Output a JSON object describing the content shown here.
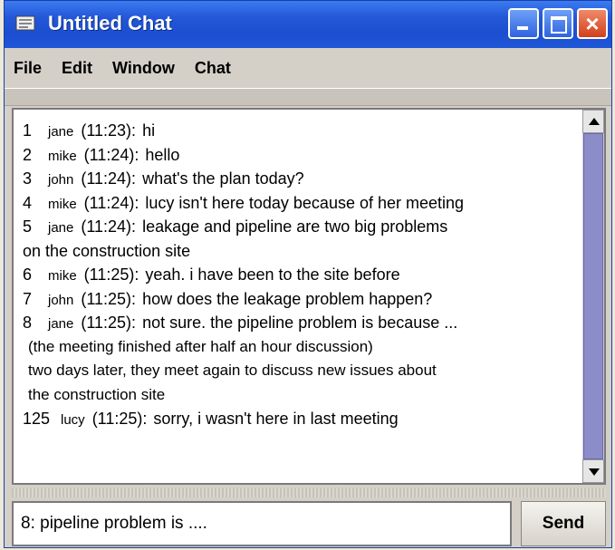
{
  "window": {
    "title": "Untitled Chat"
  },
  "menu": {
    "file": "File",
    "edit": "Edit",
    "window": "Window",
    "chat": "Chat"
  },
  "messages": [
    {
      "num": "1",
      "nick": "jane",
      "time": "(11:23):",
      "text": "hi"
    },
    {
      "num": "2",
      "nick": "mike",
      "time": "(11:24):",
      "text": "hello"
    },
    {
      "num": "3",
      "nick": "john",
      "time": "(11:24):",
      "text": "what's the plan today?"
    },
    {
      "num": "4",
      "nick": "mike",
      "time": "(11:24):",
      "text": "lucy isn't here today because of her meeting"
    },
    {
      "num": "5",
      "nick": "jane",
      "time": "(11:24):",
      "text": "leakage and pipeline are two big problems"
    },
    {
      "continuation": "on the construction site"
    },
    {
      "num": "6",
      "nick": "mike",
      "time": "(11:25):",
      "text": "yeah. i have been to the site before"
    },
    {
      "num": "7",
      "nick": "john",
      "time": "(11:25):",
      "text": "how does the leakage problem happen?"
    },
    {
      "num": "8",
      "nick": "jane",
      "time": "(11:25):",
      "text": "not sure. the pipeline problem is because ..."
    }
  ],
  "notes": [
    "(the meeting finished after half an hour discussion)",
    "two days later, they meet again to discuss new issues about",
    "the construction site"
  ],
  "last_message": {
    "num": "125",
    "nick": "lucy",
    "time": "(11:25):",
    "text": "sorry, i wasn't here in last meeting"
  },
  "input": {
    "value": "8: pipeline problem is ...."
  },
  "send_label": "Send",
  "colors": {
    "titlebar": "#2457d8",
    "close_button": "#d2401c",
    "scroll_thumb": "#8c8cc8"
  }
}
